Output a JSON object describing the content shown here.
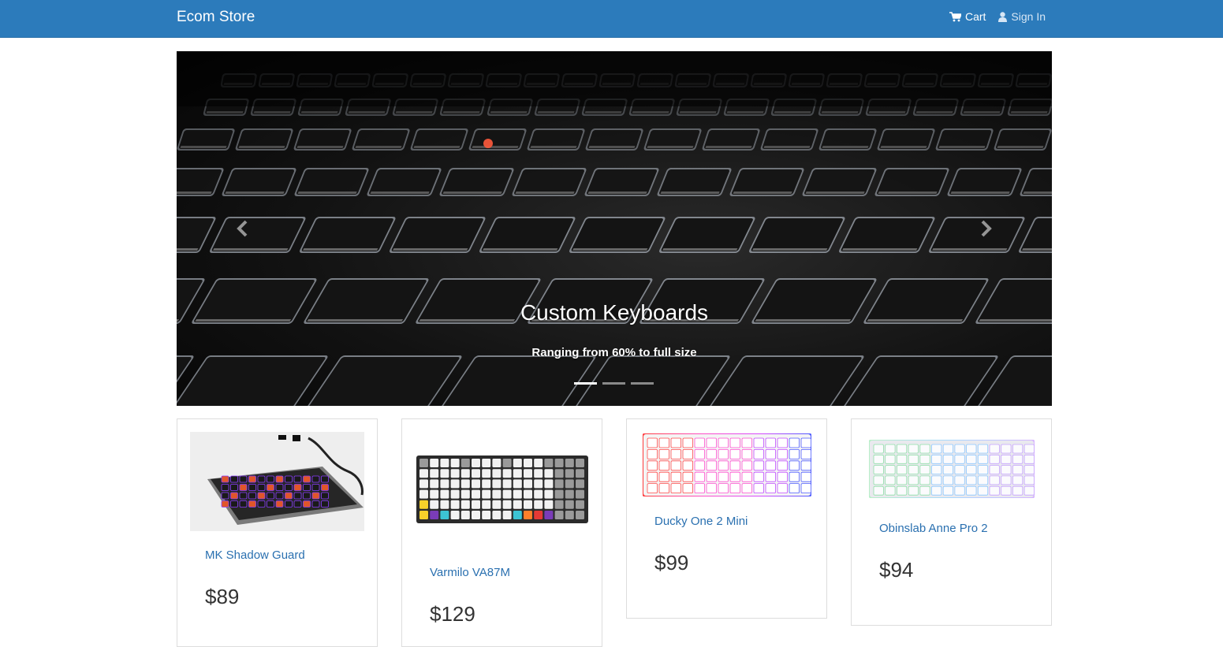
{
  "navbar": {
    "brand": "Ecom Store",
    "cart_label": "Cart",
    "signin_label": "Sign In"
  },
  "carousel": {
    "title": "Custom Keyboards",
    "subtitle": "Ranging from 60% to full size",
    "indicators": 3,
    "active_index": 0
  },
  "products": [
    {
      "name": "MK Shadow Guard",
      "price": "$89"
    },
    {
      "name": "Varmilo VA87M",
      "price": "$129"
    },
    {
      "name": "Ducky One 2 Mini",
      "price": "$99"
    },
    {
      "name": "Obinslab Anne Pro 2",
      "price": "$94"
    }
  ],
  "colors": {
    "navbar": "#2c7bbb",
    "link": "#2a70b0"
  }
}
